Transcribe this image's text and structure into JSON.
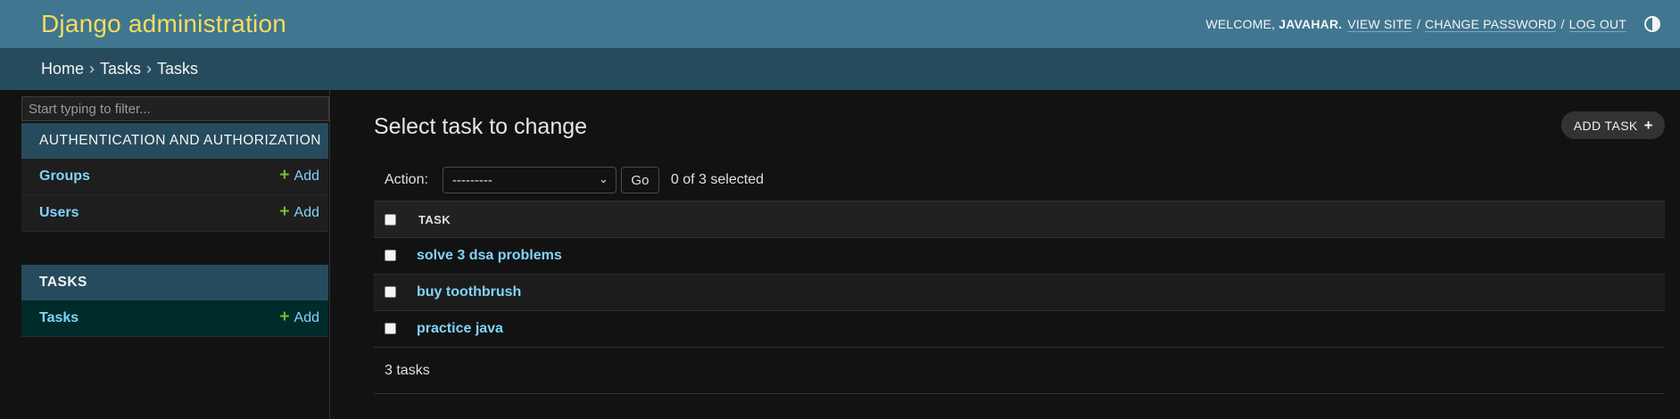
{
  "header": {
    "branding": "Django administration",
    "welcome": "WELCOME,",
    "username": "JAVAHAR.",
    "view_site": "VIEW SITE",
    "change_password": "CHANGE PASSWORD",
    "log_out": "LOG OUT",
    "separator": "/"
  },
  "breadcrumbs": {
    "home": "Home",
    "app": "Tasks",
    "model": "Tasks",
    "arrow": "›"
  },
  "sidebar": {
    "filter_placeholder": "Start typing to filter...",
    "modules": [
      {
        "caption": "AUTHENTICATION AND AUTHORIZATION",
        "models": [
          {
            "name": "Groups",
            "add": "Add"
          },
          {
            "name": "Users",
            "add": "Add"
          }
        ]
      },
      {
        "caption": "TASKS",
        "models": [
          {
            "name": "Tasks",
            "add": "Add"
          }
        ]
      }
    ]
  },
  "content": {
    "title": "Select task to change",
    "add_button": "ADD TASK",
    "action_label": "Action:",
    "action_selected": "---------",
    "go": "Go",
    "counter": "0 of 3 selected",
    "column_header": "TASK",
    "rows": [
      {
        "task": "solve 3 dsa problems"
      },
      {
        "task": "buy toothbrush"
      },
      {
        "task": "practice java"
      }
    ],
    "paginator": "3 tasks"
  },
  "colors": {
    "header_bg": "#417690",
    "breadcrumbs_bg": "#264b5d",
    "branding": "#f5dd5d",
    "link": "#81d4fa",
    "add_plus": "#70bf2b"
  }
}
